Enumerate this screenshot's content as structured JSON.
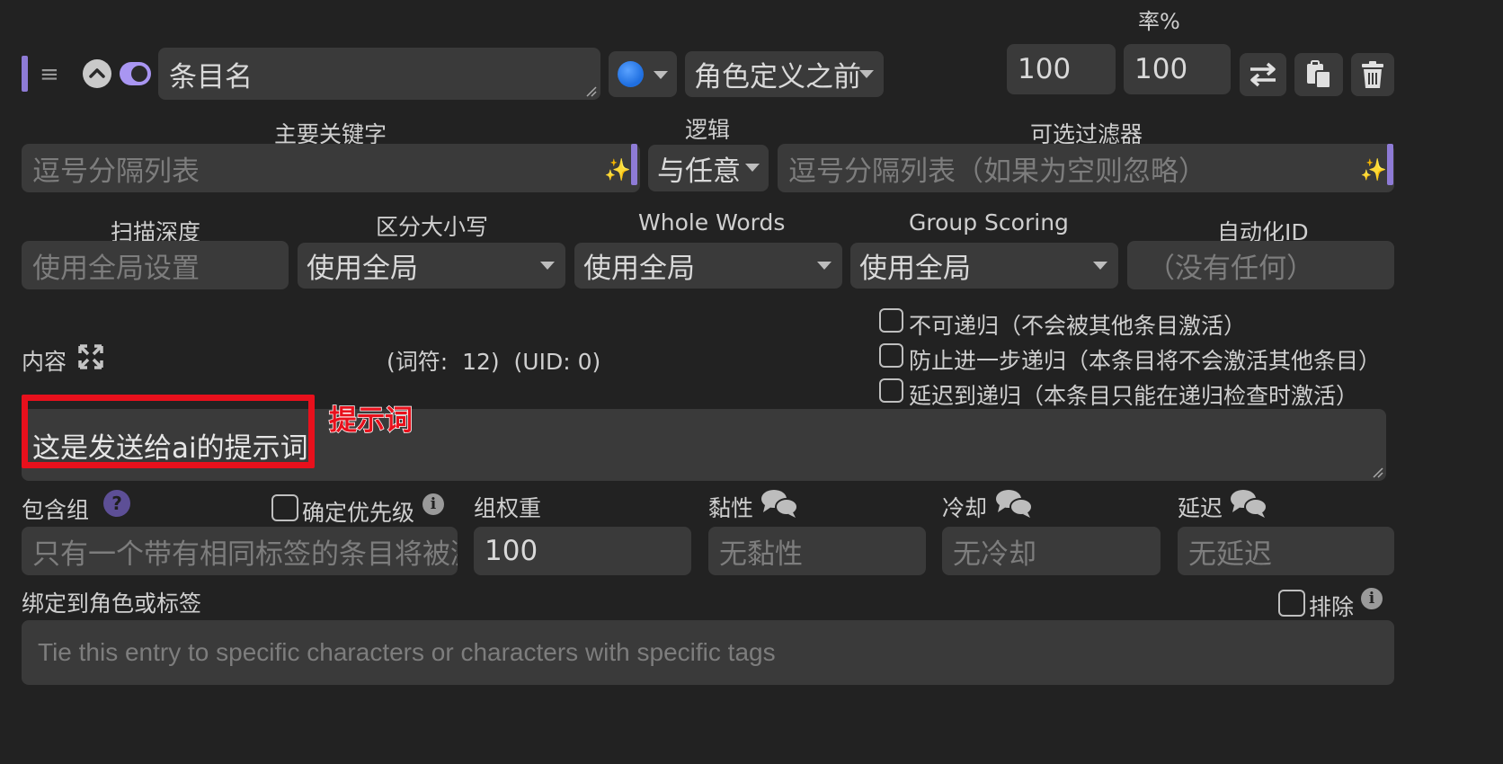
{
  "header": {
    "top_label_partial": "率%",
    "entry_title": "条目名",
    "position_value": "角色定义之前",
    "depth_value": "100",
    "probability_value": "100"
  },
  "keys": {
    "primary_label": "主要关键字",
    "primary_placeholder": "逗号分隔列表",
    "logic_label": "逻辑",
    "logic_value": "与任意",
    "secondary_label": "可选过滤器",
    "secondary_placeholder": "逗号分隔列表（如果为空则忽略）"
  },
  "settings": {
    "scan_depth_label": "扫描深度",
    "scan_depth_placeholder": "使用全局设置",
    "case_label": "区分大小写",
    "case_value": "使用全局",
    "whole_words_label": "Whole Words",
    "whole_words_value": "使用全局",
    "group_scoring_label": "Group Scoring",
    "group_scoring_value": "使用全局",
    "automation_label": "自动化ID",
    "automation_placeholder": "（没有任何）"
  },
  "recursion": {
    "non_recursable": "不可递归（不会被其他条目激活）",
    "prevent_recursion": "防止进一步递归（本条目将不会激活其他条目）",
    "delay_recursion": "延迟到递归（本条目只能在递归检查时激活）"
  },
  "content": {
    "label": "内容",
    "token_info": "(词符:  12)  (UID: 0)",
    "text": "这是发送给ai的提示词",
    "annotation": "提示词"
  },
  "group": {
    "inclusion_label": "包含组",
    "inclusion_placeholder": "只有一个带有相同标签的条目将被激活",
    "prioritize_label": "确定优先级",
    "weight_label": "组权重",
    "weight_value": "100",
    "sticky_label": "黏性",
    "sticky_placeholder": "无黏性",
    "cooldown_label": "冷却",
    "cooldown_placeholder": "无冷却",
    "delay_label": "延迟",
    "delay_placeholder": "无延迟"
  },
  "binding": {
    "label": "绑定到角色或标签",
    "exclude_label": "排除",
    "placeholder": "Tie this entry to specific characters or characters with specific tags"
  },
  "colors": {
    "background": "#222222",
    "field": "#3a3a3a",
    "accent_purple": "#8e7bd6",
    "annotation_red": "#e8101c",
    "status_blue": "#1f6fe0"
  }
}
